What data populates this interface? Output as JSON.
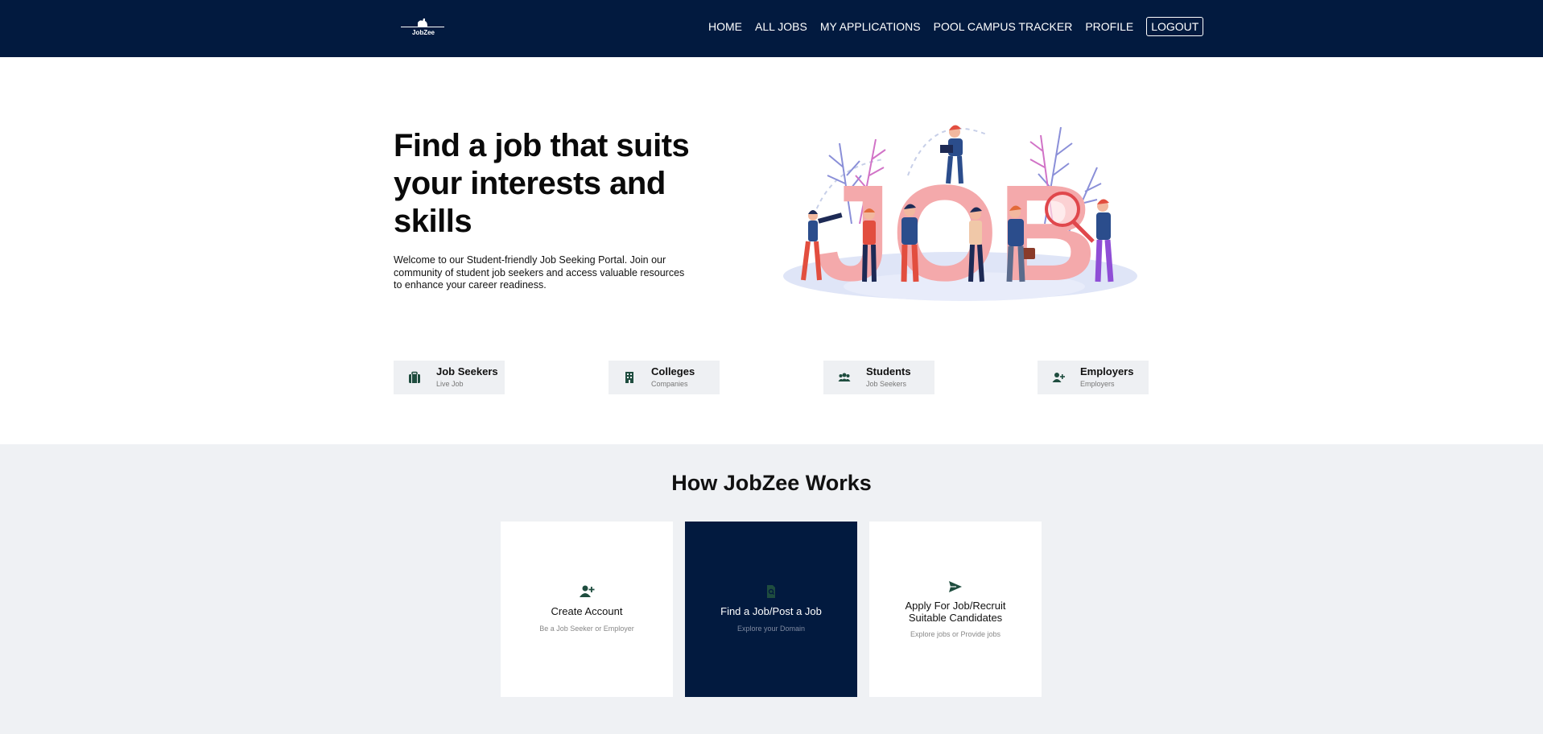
{
  "brand": {
    "logo_text": "JobZee"
  },
  "nav": {
    "links": [
      "HOME",
      "ALL JOBS",
      "MY APPLICATIONS",
      "POOL CAMPUS TRACKER",
      "PROFILE"
    ],
    "logout": "LOGOUT"
  },
  "hero": {
    "title": "Find a job that suits your interests and skills",
    "description": "Welcome to our Student-friendly Job Seeking Portal. Join our community of student job seekers and access valuable resources to enhance your career readiness.",
    "illustration_text": "JOB"
  },
  "stats": [
    {
      "label": "Job Seekers",
      "sub": "Live Job",
      "icon": "briefcase-icon"
    },
    {
      "label": "Colleges",
      "sub": "Companies",
      "icon": "building-icon"
    },
    {
      "label": "Students",
      "sub": "Job Seekers",
      "icon": "users-icon"
    },
    {
      "label": "Employers",
      "sub": "Employers",
      "icon": "user-plus-icon"
    }
  ],
  "how": {
    "title": "How JobZee Works",
    "cards": [
      {
        "title": "Create Account",
        "sub": "Be a Job Seeker or Employer",
        "icon": "user-plus-icon"
      },
      {
        "title": "Find a Job/Post a Job",
        "sub": "Explore your Domain",
        "icon": "file-search-icon"
      },
      {
        "title": "Apply For Job/Recruit Suitable Candidates",
        "sub": "Explore jobs or Provide jobs",
        "icon": "send-icon"
      }
    ]
  },
  "colors": {
    "navy": "#021a3f",
    "icon_green": "#1f4d3f",
    "stat_bg": "#eef0f3",
    "section_bg": "#eff1f4"
  }
}
